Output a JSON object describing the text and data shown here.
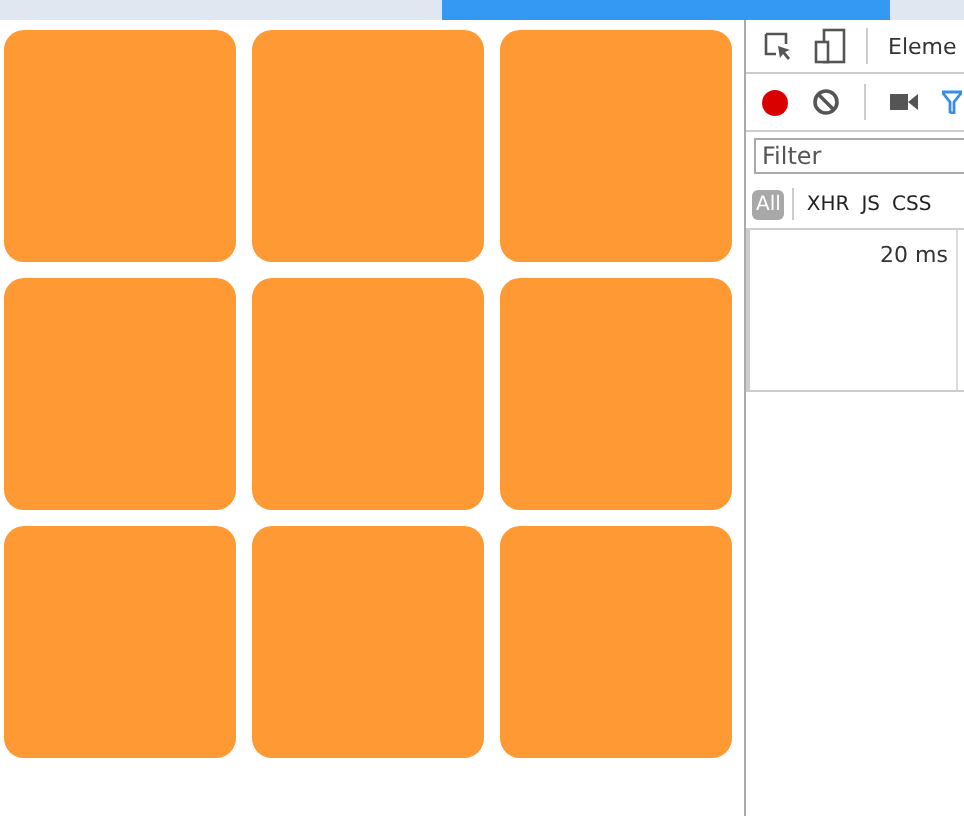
{
  "browser_tabs": [
    {
      "selected": false
    },
    {
      "selected": true
    },
    {
      "selected": false
    }
  ],
  "tiles": [
    {
      "kind": "tile"
    },
    {
      "kind": "tile"
    },
    {
      "kind": "tile"
    },
    {
      "kind": "tile"
    },
    {
      "kind": "tile"
    },
    {
      "kind": "tile"
    },
    {
      "kind": "tile"
    },
    {
      "kind": "tile"
    },
    {
      "kind": "tile"
    }
  ],
  "devtools": {
    "panel_tabs": [
      {
        "label": "Eleme",
        "selected": false
      }
    ],
    "recording": true,
    "filter": {
      "placeholder": "Filter"
    },
    "type_filters": [
      {
        "label": "All",
        "selected": true
      },
      {
        "label": "XHR",
        "selected": false
      },
      {
        "label": "JS",
        "selected": false
      },
      {
        "label": "CSS",
        "selected": false
      }
    ],
    "timeline": {
      "tick": "20 ms"
    }
  }
}
